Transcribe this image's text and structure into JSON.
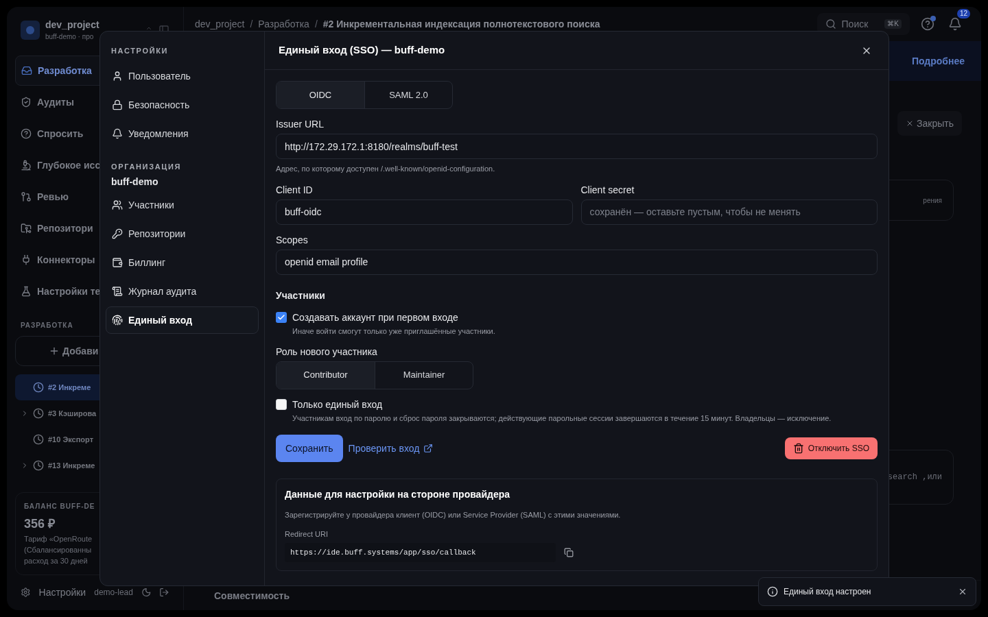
{
  "background": {
    "sidebar": {
      "project": "dev_project",
      "subtitle": "buff-demo · про",
      "nav": [
        {
          "label": "Разработка",
          "selected": true
        },
        {
          "label": "Аудиты",
          "selected": false
        },
        {
          "label": "Спросить",
          "selected": false
        },
        {
          "label": "Глубокое исс",
          "selected": false
        },
        {
          "label": "Ревью",
          "selected": false
        },
        {
          "label": "Репозитори",
          "selected": false
        },
        {
          "label": "Коннекторы",
          "selected": false
        },
        {
          "label": "Настройки те",
          "selected": false
        }
      ],
      "section": "РАЗРАБОТКА",
      "add_button": "Добави",
      "tasks": [
        {
          "label": "#2 Инкреме",
          "selected": true,
          "expandable": false
        },
        {
          "label": "#3 Кэширова",
          "selected": false,
          "expandable": true
        },
        {
          "label": "#10 Экспорт",
          "selected": false,
          "expandable": false
        },
        {
          "label": "#13 Инкреме",
          "selected": false,
          "expandable": true
        }
      ],
      "balance": {
        "title": "БАЛАНС BUFF-DE",
        "amount": "356 ₽",
        "lines": [
          "Тариф «OpenRoute",
          "(Сбалансированны",
          "расход за 30 дней"
        ]
      },
      "footer": {
        "settings": "Настройки",
        "user": "demo-lead"
      }
    },
    "topbar": {
      "separator": "/",
      "breadcrumb": [
        "dev_project",
        "Разработка",
        "#2 Инкрементальная индексация полнотекстового поиска"
      ],
      "search": "Поиск",
      "shortcut": "⌘K",
      "notifications": "12"
    },
    "main": {
      "link": "Подробнее",
      "close": "Закрыть",
      "fragment_1": "рения",
      "fragment_2": "search ,или",
      "bottom_tab": "Совместимость"
    }
  },
  "modal": {
    "title": "Единый вход (SSO) — buff-demo",
    "sidebar": {
      "heading": "НАСТРОЙКИ",
      "items": [
        {
          "label": "Пользователь",
          "selected": false
        },
        {
          "label": "Безопасность",
          "selected": false
        },
        {
          "label": "Уведомления",
          "selected": false
        }
      ],
      "org_heading": "ОРГАНИЗАЦИЯ",
      "org_name": "buff-demo",
      "org_items": [
        {
          "label": "Участники",
          "selected": false
        },
        {
          "label": "Репозитории",
          "selected": false
        },
        {
          "label": "Биллинг",
          "selected": false
        },
        {
          "label": "Журнал аудита",
          "selected": false
        },
        {
          "label": "Единый вход",
          "selected": true
        }
      ]
    },
    "form": {
      "protocols": [
        {
          "label": "OIDC",
          "selected": true
        },
        {
          "label": "SAML 2.0",
          "selected": false
        }
      ],
      "issuer": {
        "label": "Issuer URL",
        "value": "http://172.29.172.1:8180/realms/buff-test",
        "hint": "Адрес, по которому доступен /.well-known/openid-configuration."
      },
      "client_id": {
        "label": "Client ID",
        "value": "buff-oidc"
      },
      "client_secret": {
        "label": "Client secret",
        "placeholder": "сохранён — оставьте пустым, чтобы не менять"
      },
      "scopes": {
        "label": "Scopes",
        "value": "openid email profile"
      },
      "members_heading": "Участники",
      "create_account": {
        "label": "Создавать аккаунт при первом входе",
        "hint": "Иначе войти смогут только уже приглашённые участники.",
        "checked": true
      },
      "role": {
        "label": "Роль нового участника",
        "options": [
          {
            "label": "Contributor",
            "selected": true
          },
          {
            "label": "Maintainer",
            "selected": false
          }
        ]
      },
      "sso_only": {
        "label": "Только единый вход",
        "hint": "Участникам вход по паролю и сброс пароля закрываются; действующие парольные сессии завершаются в течение 15 минут. Владельцы — исключение.",
        "checked": false
      },
      "save": "Сохранить",
      "test": "Проверить вход",
      "disable": "Отключить SSO",
      "provider": {
        "title": "Данные для настройки на стороне провайдера",
        "text": "Зарегистрируйте у провайдера клиент (OIDC) или Service Provider (SAML) с этими значениями.",
        "redirect_label": "Redirect URI",
        "redirect_uri": "https://ide.buff.systems/app/sso/callback"
      }
    }
  },
  "toast": {
    "text": "Единый вход настроен"
  }
}
